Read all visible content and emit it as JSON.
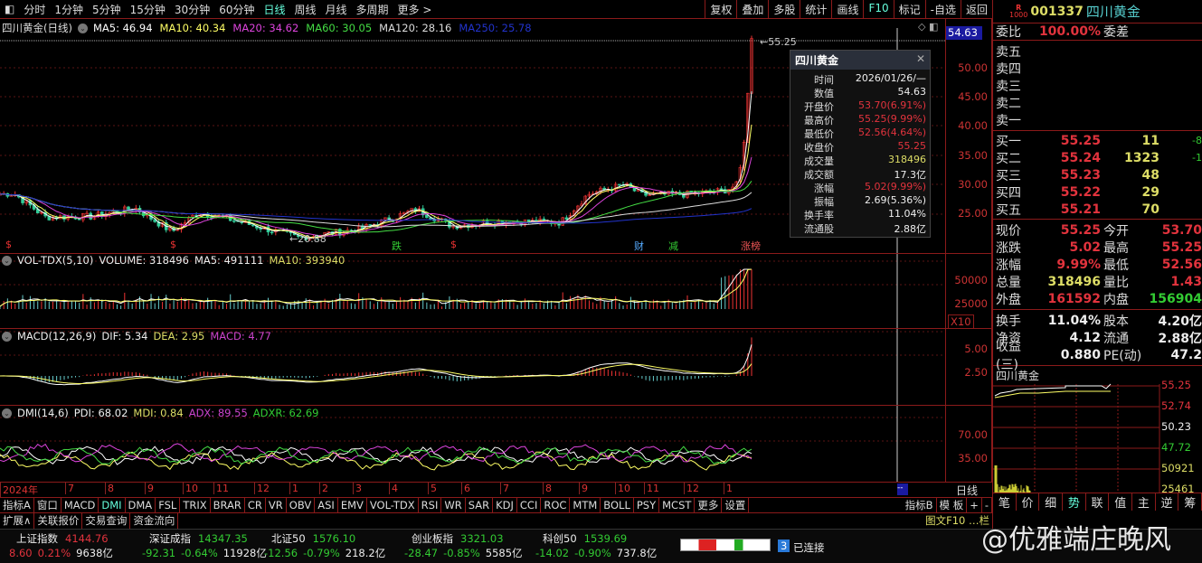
{
  "toolbar": {
    "periods": [
      "分时",
      "1分钟",
      "5分钟",
      "15分钟",
      "30分钟",
      "60分钟",
      "日线",
      "周线",
      "月线",
      "多周期",
      "更多 >"
    ],
    "active": "日线",
    "buttons": [
      "复权",
      "叠加",
      "多股",
      "统计",
      "画线",
      "F10",
      "标记",
      "-自选",
      "返回"
    ]
  },
  "main": {
    "title": "四川黄金(日线)",
    "ma": [
      {
        "label": "MA5: 46.94",
        "color": "#ffffff"
      },
      {
        "label": "MA10: 40.34",
        "color": "#ffff66"
      },
      {
        "label": "MA20: 34.62",
        "color": "#dd44dd"
      },
      {
        "label": "MA60: 30.05",
        "color": "#44dd44"
      },
      {
        "label": "MA120: 28.16",
        "color": "#dddddd"
      },
      {
        "label": "MA250: 25.78",
        "color": "#2233cc"
      }
    ],
    "price_tag": "54.63",
    "high_label": "55.25",
    "low_label": "20.88",
    "axis": [
      "50.00",
      "45.00",
      "40.00",
      "35.00",
      "30.00",
      "25.00"
    ],
    "markers": [
      {
        "t": "$",
        "c": "#e33"
      },
      {
        "t": "$",
        "c": "#e33"
      },
      {
        "t": "跌",
        "c": "#3c3"
      },
      {
        "t": "$",
        "c": "#e33"
      },
      {
        "t": "财",
        "c": "#5af"
      },
      {
        "t": "减",
        "c": "#3c3"
      },
      {
        "t": "涨榜",
        "c": "#e55"
      }
    ]
  },
  "tooltip": {
    "title": "四川黄金",
    "rows": [
      [
        "时间",
        "2026/01/26/—",
        "wht"
      ],
      [
        "数值",
        "54.63",
        "wht"
      ],
      [
        "开盘价",
        "53.70(6.91%)",
        "red"
      ],
      [
        "最高价",
        "55.25(9.99%)",
        "red"
      ],
      [
        "最低价",
        "52.56(4.64%)",
        "red"
      ],
      [
        "收盘价",
        "55.25",
        "red"
      ],
      [
        "成交量",
        "318496",
        "yel"
      ],
      [
        "成交额",
        "17.3亿",
        "wht"
      ],
      [
        "涨幅",
        "5.02(9.99%)",
        "red"
      ],
      [
        "振幅",
        "2.69(5.36%)",
        "wht"
      ],
      [
        "换手率",
        "11.04%",
        "wht"
      ],
      [
        "流通股",
        "2.88亿",
        "wht"
      ]
    ]
  },
  "vol": {
    "name": "VOL-TDX(5,10)",
    "volume": "VOLUME: 318496",
    "ma5": "MA5: 491111",
    "ma10": "MA10: 393940",
    "axis": [
      "50000",
      "25000"
    ],
    "unit": "X10"
  },
  "macd": {
    "name": "MACD(12,26,9)",
    "dif": "DIF: 5.34",
    "dea": "DEA: 2.95",
    "macd": "MACD: 4.77",
    "axis": [
      "5.00",
      "2.50"
    ]
  },
  "dmi": {
    "name": "DMI(14,6)",
    "pdi": "PDI: 68.02",
    "mdi": "MDI: 0.84",
    "adx": "ADX: 89.55",
    "adxr": "ADXR: 62.69",
    "axis": [
      "70.00",
      "35.00"
    ]
  },
  "dates": [
    "2024年",
    "7",
    "8",
    "9",
    "10",
    "11",
    "12",
    "1",
    "2",
    "3",
    "4",
    "5",
    "6",
    "7",
    "8",
    "9",
    "10",
    "11",
    "12",
    "1"
  ],
  "period_label": "日线",
  "indicators": [
    "指标A",
    "窗口",
    "MACD",
    "DMI",
    "DMA",
    "FSL",
    "TRIX",
    "BRAR",
    "CR",
    "VR",
    "OBV",
    "ASI",
    "EMV",
    "VOL-TDX",
    "RSI",
    "WR",
    "SAR",
    "KDJ",
    "CCI",
    "ROC",
    "MTM",
    "BOLL",
    "PSY",
    "MCST",
    "更多",
    "设置"
  ],
  "indicators_right": [
    "指标B",
    "模 板",
    "+",
    "-"
  ],
  "ext_tabs": [
    "扩展∧",
    "关联报价",
    "交易查询",
    "资金流向"
  ],
  "ext_right": "图文F10 …栏",
  "quote": {
    "code": "001337",
    "name": "四川黄金",
    "badge": "R",
    "badge_sub": "1000",
    "weibi": [
      "委比",
      "100.00%",
      "委差"
    ],
    "sell": [
      "卖五",
      "卖四",
      "卖三",
      "卖二",
      "卖一"
    ],
    "buy": [
      [
        "买一",
        "55.25",
        "11",
        "-8"
      ],
      [
        "买二",
        "55.24",
        "1323",
        "-1"
      ],
      [
        "买三",
        "55.23",
        "48",
        ""
      ],
      [
        "买四",
        "55.22",
        "29",
        ""
      ],
      [
        "买五",
        "55.21",
        "70",
        ""
      ]
    ],
    "stats": [
      [
        "现价",
        "55.25",
        "red",
        "今开",
        "53.70",
        "red"
      ],
      [
        "涨跌",
        "5.02",
        "red",
        "最高",
        "55.25",
        "red"
      ],
      [
        "涨幅",
        "9.99%",
        "red",
        "最低",
        "52.56",
        "red"
      ],
      [
        "总量",
        "318496",
        "yel",
        "量比",
        "1.43",
        "red"
      ],
      [
        "外盘",
        "161592",
        "red",
        "内盘",
        "156904",
        "grn"
      ]
    ],
    "fund": [
      [
        "换手",
        "11.04%",
        "股本",
        "4.20亿"
      ],
      [
        "净资",
        "4.12",
        "流通",
        "2.88亿"
      ],
      [
        "收益(三)",
        "0.880",
        "PE(动)",
        "47.2"
      ]
    ],
    "mini_title": "四川黄金",
    "mini_axis": [
      [
        "55.25",
        "red"
      ],
      [
        "52.74",
        "red"
      ],
      [
        "50.23",
        "wht"
      ],
      [
        "47.72",
        "grn"
      ],
      [
        "50921",
        "yel"
      ],
      [
        "25461",
        "yel"
      ]
    ],
    "mini_tabs": [
      "笔",
      "价",
      "细",
      "势",
      "联",
      "值",
      "主",
      "逆",
      "筹"
    ]
  },
  "status": {
    "indices": [
      {
        "name": "上证指数",
        "val": "4144.76",
        "c": "red",
        "chg": "8.60",
        "pct": "0.21%",
        "amt": "9638亿"
      },
      {
        "name": "深证成指",
        "val": "14347.35",
        "c": "grn",
        "chg": "-92.31",
        "pct": "-0.64%",
        "amt": "11928亿"
      },
      {
        "name": "北证50",
        "val": "1576.10",
        "c": "grn",
        "chg": "-12.56",
        "pct": "-0.79%",
        "amt": "218.2亿"
      },
      {
        "name": "创业板指",
        "val": "3321.03",
        "c": "grn",
        "chg": "-28.47",
        "pct": "-0.85%",
        "amt": "5585亿"
      },
      {
        "name": "科创50",
        "val": "1539.69",
        "c": "grn",
        "chg": "-14.02",
        "pct": "-0.90%",
        "amt": "737.8亿"
      }
    ],
    "conn_num": "3",
    "conn": "已连接",
    "watermark": "@优雅端庄晚风"
  }
}
